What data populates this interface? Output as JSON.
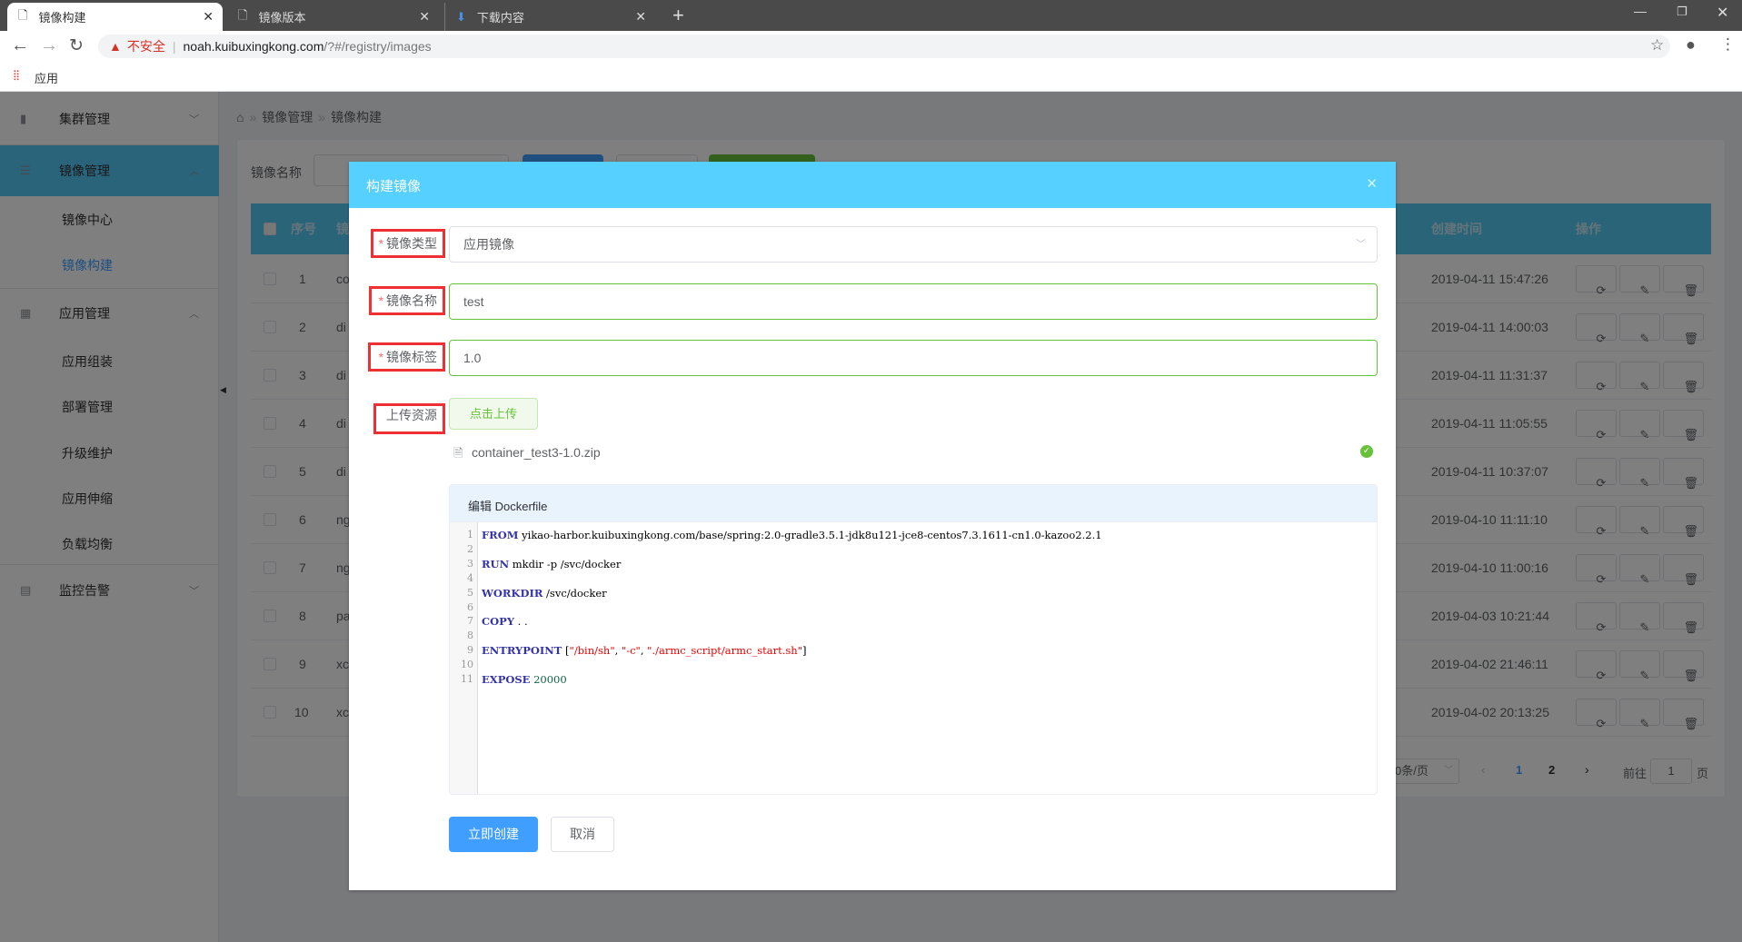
{
  "browser": {
    "tabs": [
      {
        "label": "镜像构建",
        "icon": "page-icon",
        "active": true
      },
      {
        "label": "镜像版本",
        "icon": "page-icon"
      },
      {
        "label": "下载内容",
        "icon": "download-icon"
      }
    ],
    "security_label": "不安全",
    "url_host": "noah.kuibuxingkong.com",
    "url_path": "/?#/registry/images",
    "bookmark_apps": "应用"
  },
  "sidebar": {
    "menus": [
      {
        "label": "集群管理",
        "icon": "cluster-icon",
        "expanded": false
      },
      {
        "label": "镜像管理",
        "icon": "image-icon",
        "expanded": true,
        "items": [
          "镜像中心",
          "镜像构建"
        ]
      },
      {
        "label": "应用管理",
        "icon": "grid-icon",
        "expanded": true,
        "items": [
          "应用组装",
          "部署管理",
          "升级维护",
          "应用伸缩",
          "负载均衡"
        ]
      },
      {
        "label": "监控告警",
        "icon": "monitor-icon",
        "expanded": false
      }
    ],
    "active_item": "镜像构建"
  },
  "breadcrumb": [
    "镜像管理",
    "镜像构建"
  ],
  "search": {
    "label": "镜像名称",
    "value": ""
  },
  "table": {
    "headers": {
      "index": "序号",
      "name": "镜",
      "created": "创建时间",
      "actions": "操作"
    },
    "rows": [
      {
        "index": "1",
        "name": "co",
        "created": "2019-04-11 15:47:26"
      },
      {
        "index": "2",
        "name": "di",
        "created": "2019-04-11 14:00:03"
      },
      {
        "index": "3",
        "name": "di",
        "created": "2019-04-11 11:31:37"
      },
      {
        "index": "4",
        "name": "di",
        "created": "2019-04-11 11:05:55"
      },
      {
        "index": "5",
        "name": "di",
        "created": "2019-04-11 10:37:07"
      },
      {
        "index": "6",
        "name": "ng",
        "created": "2019-04-10 11:11:10"
      },
      {
        "index": "7",
        "name": "ng",
        "created": "2019-04-10 11:00:16"
      },
      {
        "index": "8",
        "name": "pa",
        "created": "2019-04-03 10:21:44"
      },
      {
        "index": "9",
        "name": "xc",
        "created": "2019-04-02 21:46:11"
      },
      {
        "index": "10",
        "name": "xc",
        "created": "2019-04-02 20:13:25"
      }
    ]
  },
  "pagination": {
    "page_size": "0条/页",
    "pages": [
      "1",
      "2"
    ],
    "current": "1",
    "goto_label": "前往",
    "goto_value": "1",
    "page_suffix": "页"
  },
  "modal": {
    "title": "构建镜像",
    "fields": {
      "type_label": "镜像类型",
      "type_value": "应用镜像",
      "name_label": "镜像名称",
      "name_value": "test",
      "tag_label": "镜像标签",
      "tag_value": "1.0",
      "upload_label": "上传资源",
      "upload_button": "点击上传",
      "file_name": "container_test3-1.0.zip"
    },
    "editor_title": "编辑 Dockerfile",
    "dockerfile": [
      {
        "kw": "FROM",
        "rest": " yikao-harbor.kuibuxingkong.com/base/spring:2.0-gradle3.5.1-jdk8u121-jce8-centos7.3.1611-cn1.0-kazoo2.2.1"
      },
      {
        "kw": "",
        "rest": ""
      },
      {
        "kw": "RUN",
        "rest": " mkdir -p /svc/docker"
      },
      {
        "kw": "",
        "rest": ""
      },
      {
        "kw": "WORKDIR",
        "rest": " /svc/docker"
      },
      {
        "kw": "",
        "rest": ""
      },
      {
        "kw": "COPY",
        "rest": " . ."
      },
      {
        "kw": "",
        "rest": ""
      },
      {
        "kw": "ENTRYPOINT",
        "rest": " [",
        "s1": "\"/bin/sh\"",
        "s2": "\"-c\"",
        "s3": "\"./armc_script/armc_start.sh\"",
        "end": "]"
      },
      {
        "kw": "",
        "rest": ""
      },
      {
        "kw": "EXPOSE",
        "rest": " ",
        "num": "20000"
      }
    ],
    "submit": "立即创建",
    "cancel": "取消"
  },
  "colors": {
    "accent": "#409eff",
    "header": "#55d0ff",
    "success": "#67c23a",
    "danger": "#ee2f33"
  }
}
